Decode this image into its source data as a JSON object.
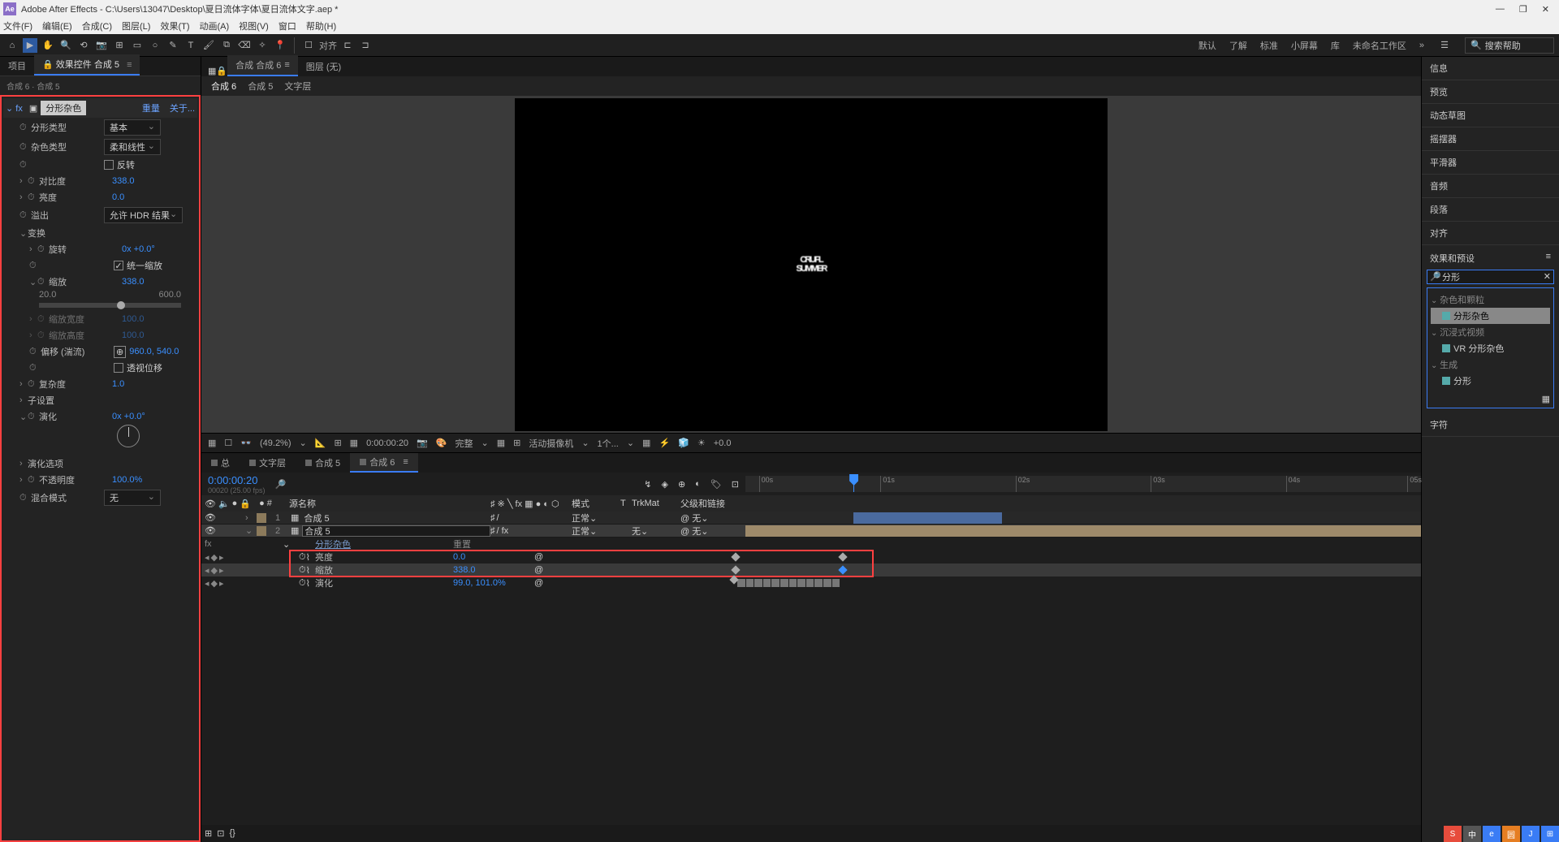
{
  "app": {
    "name": "Adobe After Effects",
    "file_path": "C:\\Users\\13047\\Desktop\\夏日流体字体\\夏日流体文字.aep *"
  },
  "menus": [
    "文件(F)",
    "编辑(E)",
    "合成(C)",
    "图层(L)",
    "效果(T)",
    "动画(A)",
    "视图(V)",
    "窗口",
    "帮助(H)"
  ],
  "toolbar": {
    "snapping_label": "对齐"
  },
  "workspaces": [
    "默认",
    "了解",
    "标准",
    "小屏幕",
    "库",
    "未命名工作区"
  ],
  "search": {
    "placeholder": "搜索帮助"
  },
  "left_tabs": {
    "project": "项目",
    "effect_controls": "效果控件 合成 5"
  },
  "breadcrumb": "合成 6 · 合成 5",
  "effect": {
    "name": "分形杂色",
    "reset": "重量",
    "about": "关于...",
    "fractal_type_label": "分形类型",
    "fractal_type_val": "基本",
    "noise_type_label": "杂色类型",
    "noise_type_val": "柔和线性",
    "invert_label": "反转",
    "contrast_label": "对比度",
    "contrast_val": "338.0",
    "brightness_label": "亮度",
    "brightness_val": "0.0",
    "overflow_label": "溢出",
    "overflow_val": "允许 HDR 结果",
    "transform_label": "变换",
    "rotation_label": "旋转",
    "rotation_val": "0x +0.0°",
    "uniform_scale_label": "统一缩放",
    "scale_label": "缩放",
    "scale_val": "338.0",
    "scale_min": "20.0",
    "scale_max": "600.0",
    "scale_w_label": "缩放宽度",
    "scale_w_val": "100.0",
    "scale_h_label": "缩放高度",
    "scale_h_val": "100.0",
    "offset_label": "偏移 (湍流)",
    "offset_val": "960.0, 540.0",
    "persp_label": "透视位移",
    "complexity_label": "复杂度",
    "complexity_val": "1.0",
    "sub_settings_label": "子设置",
    "evolution_label": "演化",
    "evolution_val": "0x +0.0°",
    "evolution_opts_label": "演化选项",
    "opacity_label": "不透明度",
    "opacity_val": "100.0%",
    "blend_label": "混合模式",
    "blend_val": "无"
  },
  "comp_tabs": {
    "comp_label": "合成 合成 6",
    "layer_label": "图层 (无)"
  },
  "comp_breadcrumb": [
    "合成 6",
    "合成 5",
    "文字层"
  ],
  "canvas": {
    "line1": "CRUFL",
    "line2": "SUMMER"
  },
  "viewer": {
    "zoom": "(49.2%)",
    "time": "0:00:00:20",
    "quality": "完整",
    "camera": "活动摄像机",
    "views": "1个...",
    "exposure": "+0.0"
  },
  "timeline": {
    "tabs": [
      "总",
      "文字层",
      "合成 5",
      "合成 6"
    ],
    "current_time": "0:00:00:20",
    "fps_info": "00020 (25.00 fps)",
    "col_source": "源名称",
    "col_mode": "模式",
    "col_trk": "TrkMat",
    "col_parent": "父级和链接",
    "ticks": [
      "00s",
      "01s",
      "02s",
      "03s",
      "04s",
      "05s"
    ],
    "layers": [
      {
        "num": "1",
        "name": "合成 5",
        "mode": "正常",
        "trk": "",
        "parent": "无"
      },
      {
        "num": "2",
        "name": "合成 5",
        "mode": "正常",
        "trk": "无",
        "parent": "无"
      }
    ],
    "effect_row": "分形杂色",
    "prop_rows": [
      {
        "name": "亮度",
        "val": "0.0"
      },
      {
        "name": "缩放",
        "val": "338.0"
      },
      {
        "name": "演化",
        "val": "99.0, 101.0%"
      }
    ]
  },
  "right": {
    "sections": [
      "信息",
      "预览",
      "动态草图",
      "摇摆器",
      "平滑器",
      "音频",
      "段落",
      "对齐"
    ],
    "effects_presets": "效果和预设",
    "search_val": "分形",
    "cats": {
      "c1": "杂色和颗粒",
      "i1": "分形杂色",
      "c2": "沉浸式视频",
      "i2": "VR 分形杂色",
      "c3": "生成",
      "i3": "分形"
    },
    "char_panel": "字符"
  },
  "status": {
    "ime": "中",
    "items": [
      "S",
      "中",
      "e",
      "圆",
      "J"
    ]
  }
}
